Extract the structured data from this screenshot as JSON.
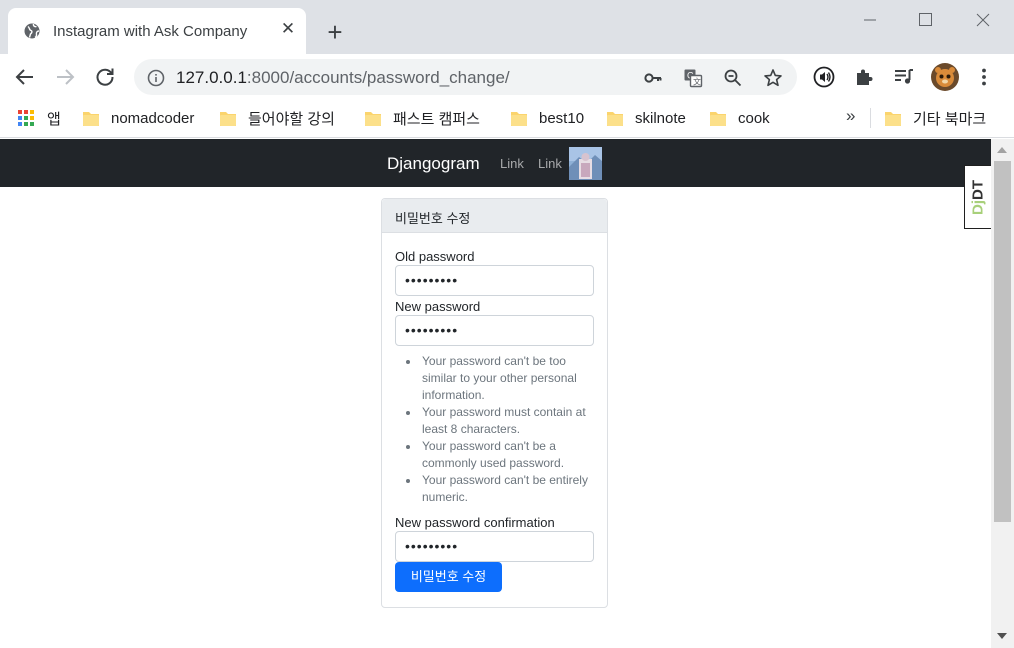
{
  "browser": {
    "tab_title": "Instagram with Ask Company",
    "url_host": "127.0.0.1",
    "url_rest": ":8000/accounts/password_change/",
    "bookmarks": [
      {
        "label": "앱",
        "icon": "apps-grid-icon"
      },
      {
        "label": "nomadcoder",
        "icon": "folder-icon"
      },
      {
        "label": "들어야할 강의",
        "icon": "folder-icon"
      },
      {
        "label": "패스트 캠퍼스",
        "icon": "folder-icon"
      },
      {
        "label": "best10",
        "icon": "folder-icon"
      },
      {
        "label": "skilnote",
        "icon": "folder-icon"
      },
      {
        "label": "cook",
        "icon": "folder-icon"
      }
    ],
    "bookmarks_more": "»",
    "other_bookmarks": "기타 북마크"
  },
  "navbar": {
    "brand": "Djangogram",
    "links": [
      "Link",
      "Link"
    ]
  },
  "card": {
    "header": "비밀번호 수정",
    "fields": [
      {
        "label": "Old password",
        "value": "•••••••••"
      },
      {
        "label": "New password",
        "value": "•••••••••"
      },
      {
        "label": "New password confirmation",
        "value": "•••••••••"
      }
    ],
    "help": [
      "Your password can't be too similar to your other personal information.",
      "Your password must contain at least 8 characters.",
      "Your password can't be a commonly used password.",
      "Your password can't be entirely numeric."
    ],
    "submit_label": "비밀번호 수정"
  },
  "debug_toolbar": {
    "prefix": "Dj",
    "suffix": "DT"
  },
  "colors": {
    "navbar_bg": "#212529",
    "primary": "#0d6efd",
    "card_header_bg": "#e9ecef",
    "folder": "#fbd46d"
  }
}
